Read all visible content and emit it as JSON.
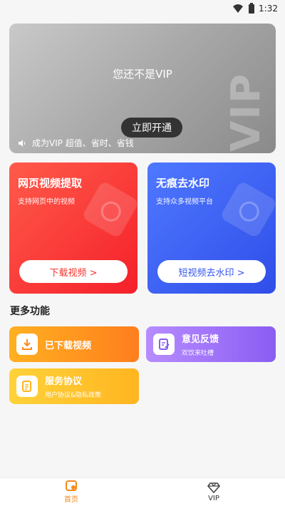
{
  "status_bar": {
    "time": "1:32"
  },
  "vip_banner": {
    "title": "您还不是VIP",
    "button_label": "立即开通",
    "tip": "成为VIP 超值、省时、省钱",
    "watermark": "VIP"
  },
  "feature_cards": [
    {
      "title": "网页视频提取",
      "subtitle": "支持网页中的视频",
      "button_label": "下载视频 >"
    },
    {
      "title": "无痕去水印",
      "subtitle": "支持众多视频平台",
      "button_label": "短视频去水印 >"
    }
  ],
  "more_section": {
    "title": "更多功能"
  },
  "functions": [
    {
      "title": "已下载视频",
      "subtitle": ""
    },
    {
      "title": "意见反馈",
      "subtitle": "欢饮来吐槽"
    },
    {
      "title": "服务协议",
      "subtitle": "用户协议&隐私政策"
    }
  ],
  "bottom_nav": [
    {
      "label": "首页",
      "active": true
    },
    {
      "label": "VIP",
      "active": false
    }
  ],
  "colors": {
    "accent_orange": "#f08a1c",
    "card_red": "#f5202a",
    "card_blue": "#2f4ee8",
    "vip_gray": "#a8a8a8"
  }
}
